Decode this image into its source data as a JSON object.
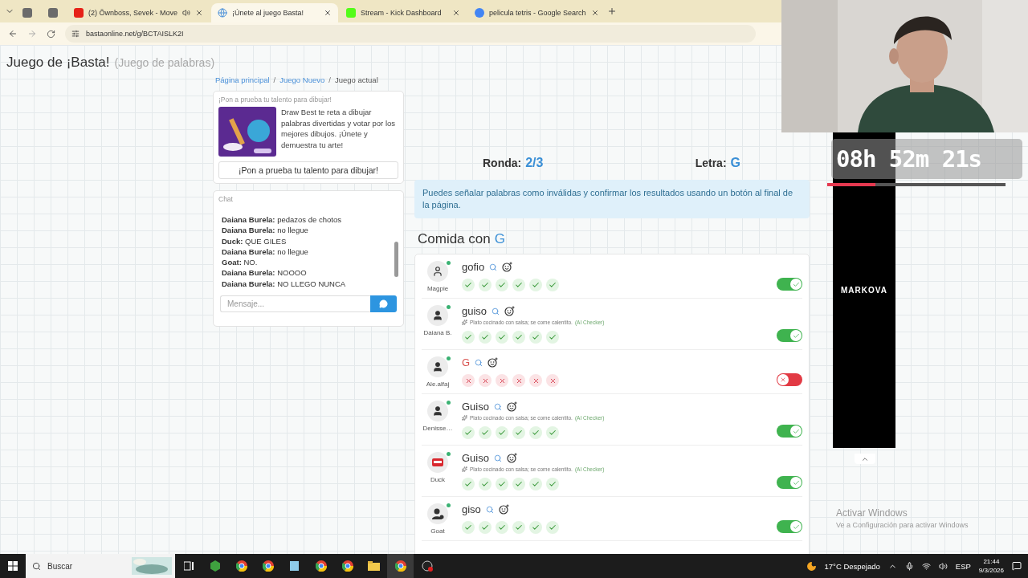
{
  "browser": {
    "tabs": [
      {
        "kind": "pinned",
        "selected": false
      },
      {
        "kind": "pinned",
        "selected": false
      },
      {
        "kind": "youtube",
        "title": "(2) Öwnboss, Sevek - Move",
        "audio": true,
        "selected": false
      },
      {
        "kind": "globe",
        "title": "¡Únete al juego Basta!",
        "audio": false,
        "selected": true
      },
      {
        "kind": "kick",
        "title": "Stream - Kick Dashboard",
        "audio": false,
        "selected": false
      },
      {
        "kind": "google",
        "title": "pelicula tetris - Google Search",
        "audio": false,
        "selected": false
      }
    ],
    "url": "bastaonline.net/g/BCTAISLK2I"
  },
  "page": {
    "title": "Juego de ¡Basta!",
    "subtitle": "(Juego de palabras)",
    "breadcrumb_separator": "/",
    "breadcrumb": [
      {
        "label": "Página principal",
        "link": true
      },
      {
        "label": "Juego Nuevo",
        "link": true
      },
      {
        "label": "Juego actual",
        "link": false
      }
    ],
    "promo": {
      "heading": "¡Pon a prueba tu talento para dibujar!",
      "text": "Draw Best te reta a dibujar palabras divertidas y votar por los mejores dibujos. ¡Únete y demuestra tu arte!",
      "button": "¡Pon a prueba tu talento para dibujar!"
    },
    "chat": {
      "label": "Chat",
      "messages": [
        {
          "author": "Daiana Burela:",
          "text": "pedazos de chotos"
        },
        {
          "author": "Daiana Burela:",
          "text": "no llegue"
        },
        {
          "author": "Duck:",
          "text": "QUE GILES"
        },
        {
          "author": "Daiana Burela:",
          "text": "no llegue"
        },
        {
          "author": "Goat:",
          "text": "NO."
        },
        {
          "author": "Daiana Burela:",
          "text": "NOOOO"
        },
        {
          "author": "Daiana Burela:",
          "text": "NO LLEGO NUNCA"
        }
      ],
      "placeholder": "Mensaje..."
    },
    "round": {
      "label": "Ronda:",
      "value": "2/3"
    },
    "letter": {
      "label": "Letra:",
      "value": "G"
    },
    "info": "Puedes señalar palabras como inválidas y confirmar los resultados usando un botón al final de la página.",
    "category": {
      "prefix": "Comida con",
      "letter": "G"
    },
    "answers": [
      {
        "player": "Magpie",
        "kind": "outline",
        "online": true,
        "word": "gofio",
        "accepted": true,
        "votes": [
          {
            "valid": true
          },
          {
            "valid": true
          },
          {
            "valid": true
          },
          {
            "valid": true
          },
          {
            "valid": true
          },
          {
            "valid": true
          }
        ]
      },
      {
        "player": "Daiana B.",
        "kind": "solid",
        "online": true,
        "word": "guiso",
        "note": {
          "text": "Plato cocinado con salsa; se come calentito.",
          "source": "(AI Checker)"
        },
        "accepted": true,
        "votes": [
          {
            "valid": true
          },
          {
            "valid": true
          },
          {
            "valid": true
          },
          {
            "valid": true
          },
          {
            "valid": true
          },
          {
            "valid": true
          }
        ]
      },
      {
        "player": "Ale.alfaj",
        "kind": "solid",
        "online": true,
        "word": "G",
        "accepted": false,
        "votes": [
          {
            "valid": false
          },
          {
            "valid": false
          },
          {
            "valid": false
          },
          {
            "valid": false
          },
          {
            "valid": false
          },
          {
            "valid": false
          }
        ]
      },
      {
        "player": "Denisse…",
        "kind": "solid",
        "online": true,
        "word": "Guiso",
        "note": {
          "text": "Plato cocinado con salsa; se come calentito.",
          "source": "(AI Checker)"
        },
        "accepted": true,
        "votes": [
          {
            "valid": true
          },
          {
            "valid": true
          },
          {
            "valid": true
          },
          {
            "valid": true
          },
          {
            "valid": true
          },
          {
            "valid": true
          }
        ]
      },
      {
        "player": "Duck",
        "kind": "stop",
        "online": true,
        "word": "Guiso",
        "note": {
          "text": "Plato cocinado con salsa; se come calentito.",
          "source": "(AI Checker)"
        },
        "accepted": true,
        "votes": [
          {
            "valid": true
          },
          {
            "valid": true
          },
          {
            "valid": true
          },
          {
            "valid": true
          },
          {
            "valid": true
          },
          {
            "valid": true
          }
        ]
      },
      {
        "player": "Goat",
        "kind": "star",
        "online": true,
        "word": "giso",
        "accepted": true,
        "votes": [
          {
            "valid": true
          },
          {
            "valid": true
          },
          {
            "valid": true
          },
          {
            "valid": true
          },
          {
            "valid": true
          },
          {
            "valid": true
          }
        ]
      }
    ]
  },
  "overlay": {
    "timer": "08h 52m 21s",
    "progress": {
      "level": 0.27
    },
    "banner": "MARKOVA",
    "watermark": {
      "title": "Activar Windows",
      "text": "Ve a Configuración para activar Windows"
    }
  },
  "taskbar": {
    "search_placeholder": "Buscar",
    "weather": "17°C Despejado",
    "language": "ESP",
    "time": "21:44",
    "date": "9/3/2026"
  }
}
